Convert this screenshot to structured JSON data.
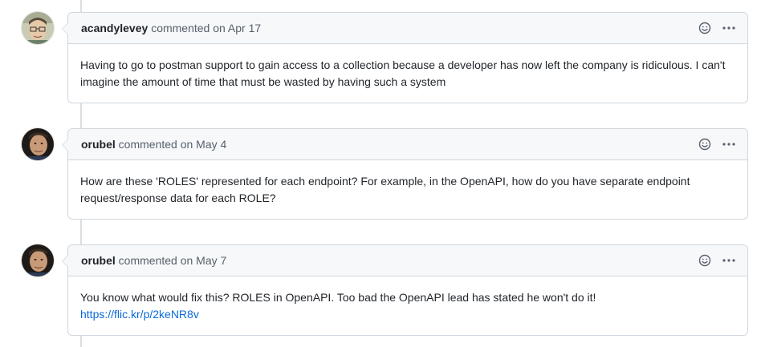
{
  "comments": [
    {
      "author": "acandylevey",
      "action": "commented",
      "date": "on Apr 17",
      "body": "Having to go to postman support to gain access to a collection because a developer has now left the company is ridiculous. I can't imagine the amount of time that must be wasted by having such a system",
      "link": ""
    },
    {
      "author": "orubel",
      "action": "commented",
      "date": "on May 4",
      "body": "How are these 'ROLES' represented for each endpoint? For example, in the OpenAPI, how do you have separate endpoint request/response data for each ROLE?",
      "link": ""
    },
    {
      "author": "orubel",
      "action": "commented",
      "date": "on May 7",
      "body": "You know what would fix this? ROLES in OpenAPI. Too bad the OpenAPI lead has stated he won't do it!",
      "link": "https://flic.kr/p/2keNR8v"
    }
  ],
  "icons": {
    "reaction": "smiley-icon",
    "menu": "kebab-horizontal-icon"
  },
  "colors": {
    "header_bg": "#f6f8fa",
    "border": "#d0d7de",
    "link": "#0969da",
    "muted_text": "#57606a"
  }
}
